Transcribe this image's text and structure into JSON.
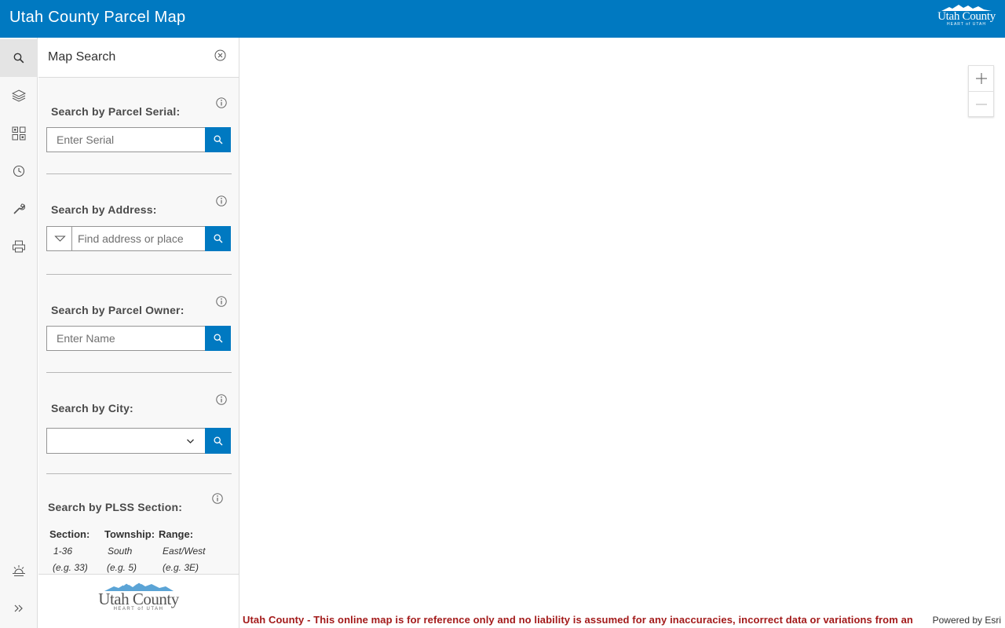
{
  "header": {
    "title": "Utah County Parcel Map",
    "logo_name": "Utah County",
    "logo_tagline": "HEART of UTAH"
  },
  "iconbar": {
    "items": [
      {
        "icon": "search-icon",
        "active": true
      },
      {
        "icon": "layers-icon",
        "active": false
      },
      {
        "icon": "basemap-gallery-icon",
        "active": false
      },
      {
        "icon": "clock-icon",
        "active": false
      },
      {
        "icon": "wrench-icon",
        "active": false
      },
      {
        "icon": "print-icon",
        "active": false
      },
      {
        "icon": "sunrise-icon",
        "active": false
      },
      {
        "icon": "expand-chevrons-icon",
        "active": false
      }
    ]
  },
  "panel": {
    "title": "Map Search",
    "serial": {
      "label": "Search by Parcel Serial:",
      "placeholder": "Enter Serial",
      "value": ""
    },
    "address": {
      "label": "Search by Address:",
      "placeholder": "Find address or place",
      "value": ""
    },
    "owner": {
      "label": "Search by Parcel Owner:",
      "placeholder": "Enter Name",
      "value": ""
    },
    "city": {
      "label": "Search by City:",
      "selected": ""
    },
    "plss": {
      "label": "Search by PLSS Section:",
      "section": {
        "label": "Section:",
        "hint1": "1-36",
        "hint2": "(e.g. 33)"
      },
      "township": {
        "label": "Township:",
        "hint1": "South",
        "hint2": "(e.g. 5)"
      },
      "range": {
        "label": "Range:",
        "hint1": "East/West",
        "hint2": "(e.g. 3E)"
      }
    },
    "footer_logo": {
      "name": "Utah County",
      "tagline": "HEART of UTAH"
    }
  },
  "map": {
    "disclaimer": "Utah County - This online map is for reference only and no liability is assumed for any inaccuracies, incorrect data or variations from an",
    "powered_by": "Powered by Esri"
  },
  "colors": {
    "brand_blue": "#0079c1",
    "disclaimer_red": "#a31a1a"
  }
}
